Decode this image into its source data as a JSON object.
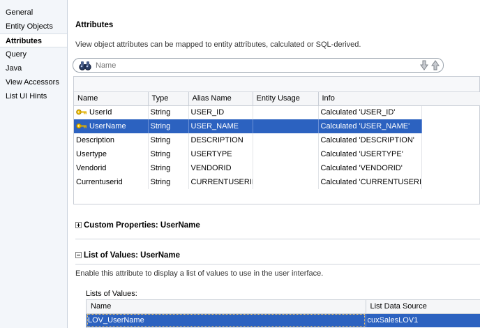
{
  "nav": {
    "items": [
      {
        "label": "General"
      },
      {
        "label": "Entity Objects"
      },
      {
        "label": "Attributes",
        "selected": true
      },
      {
        "label": "Query"
      },
      {
        "label": "Java"
      },
      {
        "label": "View Accessors"
      },
      {
        "label": "List UI Hints"
      }
    ]
  },
  "section": {
    "title": "Attributes",
    "description": "View object attributes can be mapped to entity attributes, calculated or SQL-derived."
  },
  "search": {
    "placeholder": "Name",
    "icon": "binoculars-icon"
  },
  "attributes": {
    "columns": [
      "Name",
      "Type",
      "Alias Name",
      "Entity Usage",
      "Info"
    ],
    "rows": [
      {
        "name": "UserId",
        "type": "String",
        "alias": "USER_ID",
        "usage": "",
        "info": "Calculated 'USER_ID'",
        "key": true,
        "selected": false
      },
      {
        "name": "UserName",
        "type": "String",
        "alias": "USER_NAME",
        "usage": "",
        "info": "Calculated 'USER_NAME'",
        "key": true,
        "selected": true
      },
      {
        "name": "Description",
        "type": "String",
        "alias": "DESCRIPTION",
        "usage": "",
        "info": "Calculated 'DESCRIPTION'",
        "key": false,
        "selected": false
      },
      {
        "name": "Usertype",
        "type": "String",
        "alias": "USERTYPE",
        "usage": "",
        "info": "Calculated 'USERTYPE'",
        "key": false,
        "selected": false
      },
      {
        "name": "Vendorid",
        "type": "String",
        "alias": "VENDORID",
        "usage": "",
        "info": "Calculated 'VENDORID'",
        "key": false,
        "selected": false
      },
      {
        "name": "Currentuserid",
        "type": "String",
        "alias": "CURRENTUSERID",
        "usage": "",
        "info": "Calculated 'CURRENTUSERID'",
        "key": false,
        "selected": false
      }
    ]
  },
  "custom_properties": {
    "title": "Custom Properties: UserName",
    "expanded": false
  },
  "lov": {
    "title": "List of Values: UserName",
    "expanded": true,
    "description": "Enable this attribute to display a list of values to use in the user interface.",
    "list_label": "Lists of Values:",
    "columns": [
      "Name",
      "List Data Source"
    ],
    "rows": [
      {
        "name": "LOV_UserName",
        "source": "cuxSalesLOV1"
      }
    ]
  },
  "colors": {
    "selection": "#2c62c0",
    "nav_bg": "#f3f6fa"
  }
}
